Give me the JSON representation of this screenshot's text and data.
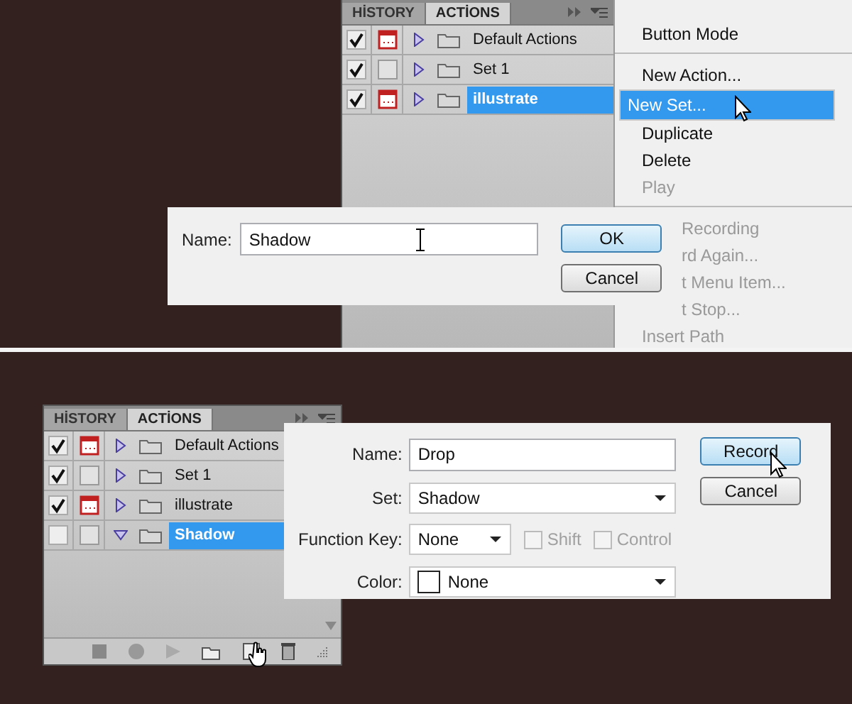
{
  "top_scene": {
    "actions_panel": {
      "tabs": [
        {
          "label": "HİSTORY",
          "selected": false
        },
        {
          "label": "ACTİONS",
          "selected": true
        }
      ],
      "rows": [
        {
          "name": "Default Actions",
          "checked": true,
          "dialog_on": true,
          "expanded": false,
          "selected": false
        },
        {
          "name": "Set 1",
          "checked": true,
          "dialog_on": false,
          "expanded": false,
          "selected": false
        },
        {
          "name": "illustrate",
          "checked": true,
          "dialog_on": true,
          "expanded": false,
          "selected": true
        }
      ]
    },
    "panel_menu": {
      "groups": [
        [
          {
            "label": "Button Mode",
            "kind": "item",
            "disabled": false,
            "selected": false
          }
        ],
        [
          {
            "label": "New Action...",
            "kind": "item",
            "disabled": false,
            "selected": false
          },
          {
            "label": "New Set...",
            "kind": "item",
            "disabled": false,
            "selected": true
          },
          {
            "label": "Duplicate",
            "kind": "item",
            "disabled": false,
            "selected": false
          },
          {
            "label": "Delete",
            "kind": "item",
            "disabled": false,
            "selected": false
          },
          {
            "label": "Play",
            "kind": "item",
            "disabled": true,
            "selected": false
          }
        ],
        [
          {
            "label": "Recording",
            "kind": "partial",
            "disabled": true,
            "selected": false
          },
          {
            "label": "rd Again...",
            "kind": "partial",
            "disabled": true,
            "selected": false
          },
          {
            "label": "t Menu Item...",
            "kind": "partial",
            "disabled": true,
            "selected": false
          },
          {
            "label": "t Stop...",
            "kind": "partial",
            "disabled": true,
            "selected": false
          },
          {
            "label": "Insert Path",
            "kind": "item",
            "disabled": true,
            "selected": false
          }
        ]
      ]
    },
    "new_set_dialog": {
      "name_label": "Name:",
      "name_value": "Shadow",
      "buttons": [
        {
          "label": "OK",
          "default": true
        },
        {
          "label": "Cancel",
          "default": false
        }
      ]
    }
  },
  "bottom_scene": {
    "actions_panel": {
      "tabs": [
        {
          "label": "HİSTORY",
          "selected": false
        },
        {
          "label": "ACTİONS",
          "selected": true
        }
      ],
      "rows": [
        {
          "name": "Default Actions",
          "checked": true,
          "dialog_on": true,
          "expanded": false,
          "selected": false
        },
        {
          "name": "Set 1",
          "checked": true,
          "dialog_on": false,
          "expanded": false,
          "selected": false
        },
        {
          "name": "illustrate",
          "checked": true,
          "dialog_on": true,
          "expanded": false,
          "selected": false
        },
        {
          "name": "Shadow",
          "checked": false,
          "dialog_on": false,
          "expanded": true,
          "selected": true
        }
      ]
    },
    "new_action_dialog": {
      "fields": [
        {
          "kind": "text",
          "label": "Name:",
          "value": "Drop"
        },
        {
          "kind": "select",
          "label": "Set:",
          "value": "Shadow"
        },
        {
          "kind": "key",
          "label": "Function Key:",
          "value": "None",
          "options": [
            {
              "label": "Shift",
              "checked": false,
              "disabled": true
            },
            {
              "label": "Control",
              "checked": false,
              "disabled": true
            }
          ]
        },
        {
          "kind": "color",
          "label": "Color:",
          "value": "None"
        }
      ],
      "buttons": [
        {
          "label": "Record",
          "default": true
        },
        {
          "label": "Cancel",
          "default": false
        }
      ]
    }
  }
}
